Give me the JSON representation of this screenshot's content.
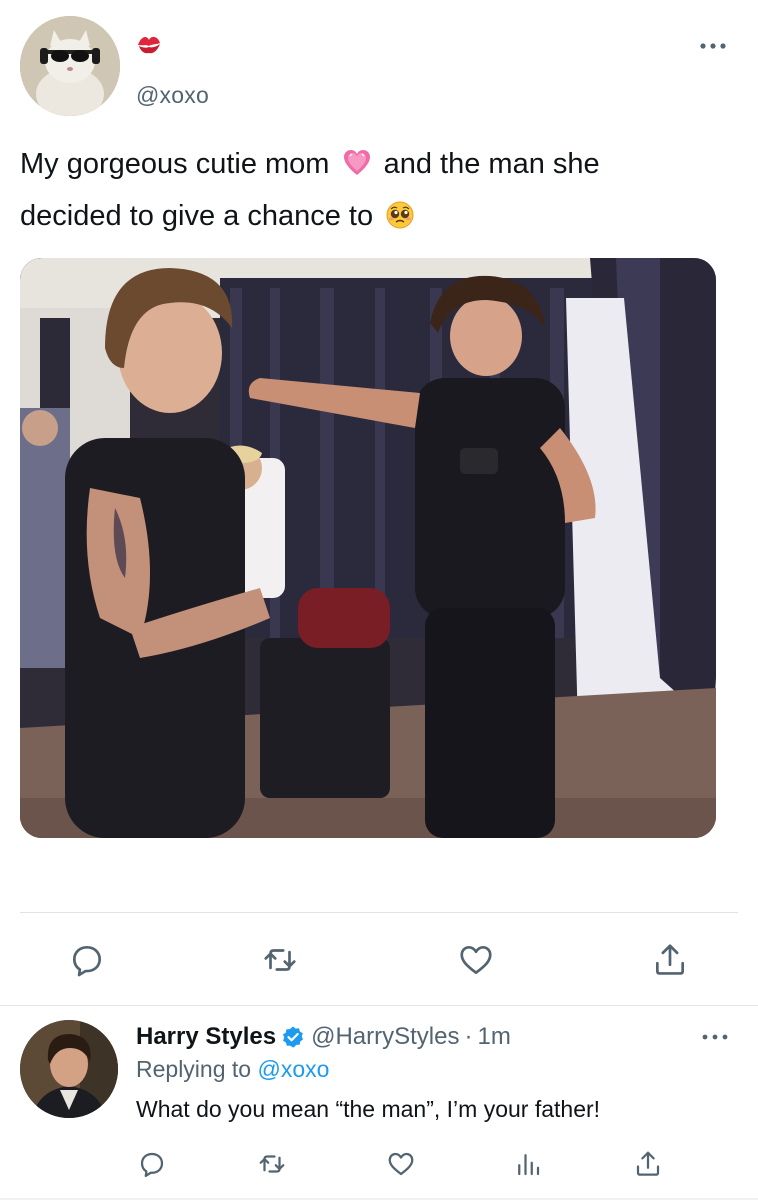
{
  "tweet": {
    "handle": "@xoxo",
    "name_icon": "kiss-mark-icon",
    "text_line_1": "My gorgeous cutie mom",
    "text_emoji_1": "pink-heart-icon",
    "text_line_1b": "and the man she",
    "text_line_2": "decided to give a chance to",
    "text_emoji_2": "pleading-face-icon",
    "photo_label": "photo",
    "actions": [
      "reply-icon",
      "retweet-icon",
      "like-icon",
      "share-icon"
    ]
  },
  "reply": {
    "name": "Harry Styles",
    "verified": true,
    "handle": "@HarryStyles",
    "separator": "·",
    "time": "1m",
    "replying_prefix": "Replying to",
    "replying_handle": "@xoxo",
    "text": "What do you mean “the man”, I’m your father!",
    "actions": [
      "reply-icon",
      "retweet-icon",
      "like-icon",
      "analytics-icon",
      "share-icon"
    ]
  },
  "colors": {
    "text": "#0f1419",
    "secondary": "#536471",
    "accent": "#1d9bf0",
    "divider": "#dfe3e6",
    "kiss": "#e0263c"
  }
}
